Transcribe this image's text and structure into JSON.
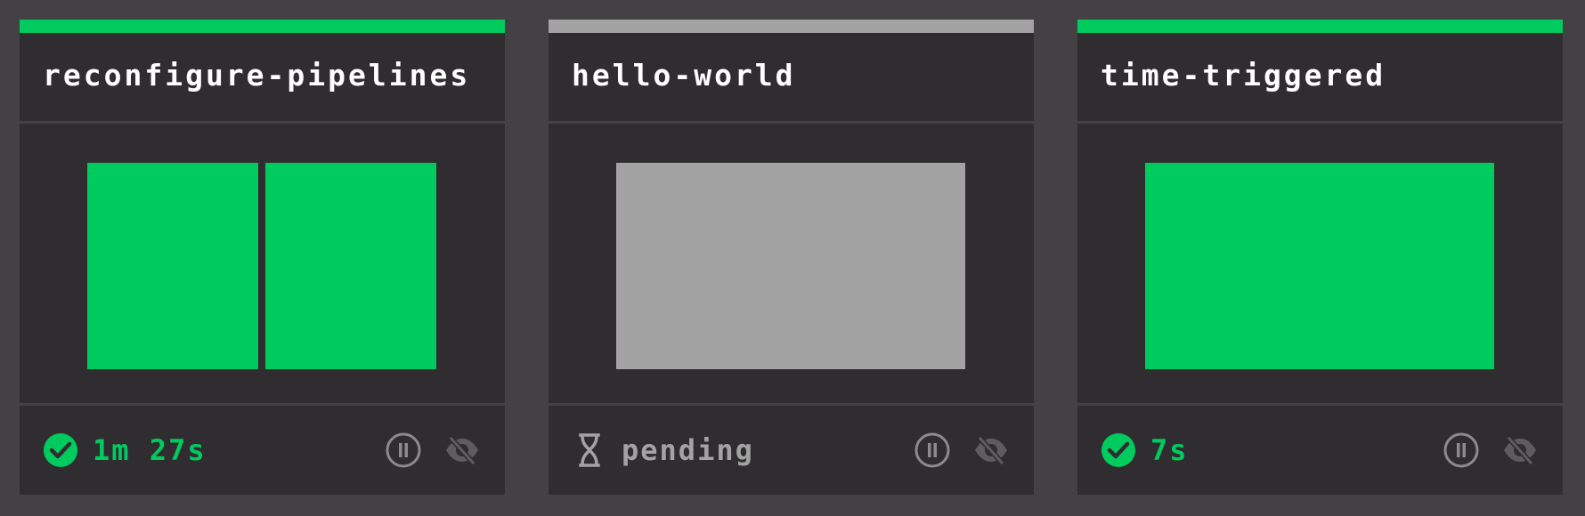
{
  "colors": {
    "page_bg": "#434143",
    "card_bg": "#2f2d2f",
    "succeeded": "#00cb5f",
    "pending": "#a3a3a3",
    "icon_muted": "#8c8a8c"
  },
  "pipelines": [
    {
      "name": "reconfigure-pipelines",
      "status": "succeeded",
      "status_text": "1m 27s",
      "status_icon": "check-circle-icon",
      "job_count": 2
    },
    {
      "name": "hello-world",
      "status": "pending",
      "status_text": "pending",
      "status_icon": "hourglass-icon",
      "job_count": 1
    },
    {
      "name": "time-triggered",
      "status": "succeeded",
      "status_text": "7s",
      "status_icon": "check-circle-icon",
      "job_count": 1
    }
  ],
  "icons": {
    "pause": "pause-circle-icon",
    "hide": "eye-slash-icon"
  }
}
